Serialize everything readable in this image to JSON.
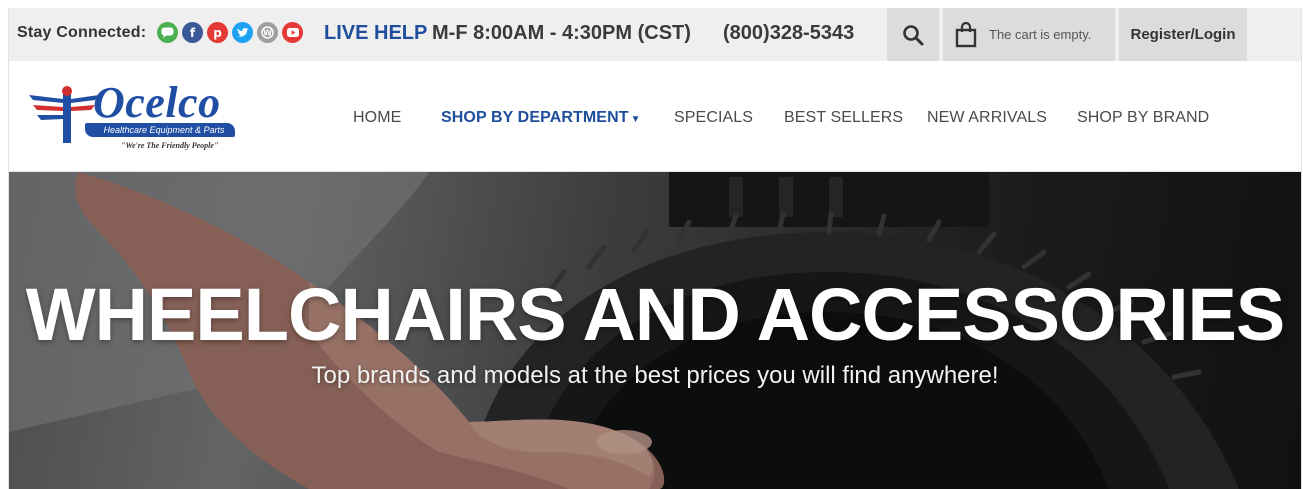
{
  "topbar": {
    "stay_connected": "Stay Connected:",
    "socials": [
      {
        "name": "chat",
        "color": "#4caf50"
      },
      {
        "name": "facebook",
        "color": "#3b5998"
      },
      {
        "name": "pinterest",
        "color": "#e53935"
      },
      {
        "name": "twitter",
        "color": "#1da1f2"
      },
      {
        "name": "wordpress",
        "color": "#9e9e9e"
      },
      {
        "name": "youtube",
        "color": "#e53935"
      }
    ],
    "live_help": "LIVE HELP",
    "hours": "M-F 8:00AM - 4:30PM (CST)",
    "phone": "(800)328-5343",
    "cart_text": "The cart is empty.",
    "login": "Register/Login"
  },
  "logo": {
    "name": "Ocelco",
    "subtitle": "Healthcare Equipment & Parts",
    "tagline": "\"We're The Friendly People\""
  },
  "nav": {
    "items": [
      "HOME",
      "SHOP BY DEPARTMENT",
      "SPECIALS",
      "BEST SELLERS",
      "NEW ARRIVALS",
      "SHOP BY BRAND"
    ]
  },
  "hero": {
    "title": "WHEELCHAIRS AND ACCESSORIES",
    "subtitle": "Top brands and models at the best prices you will find anywhere!"
  },
  "colors": {
    "brand_blue": "#1e4e9c",
    "topbar_bg": "#efefef",
    "button_bg": "#dcdcdc"
  }
}
